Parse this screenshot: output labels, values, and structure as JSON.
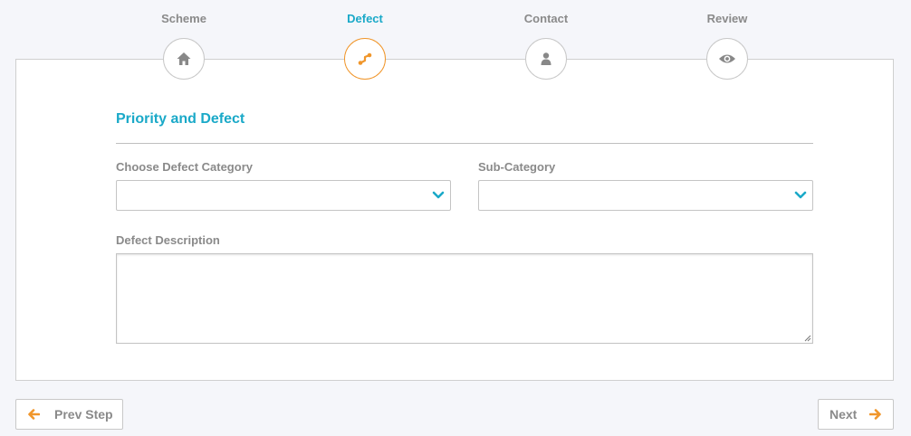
{
  "wizard": {
    "steps": [
      {
        "label": "Scheme",
        "icon": "home-icon",
        "active": false
      },
      {
        "label": "Defect",
        "icon": "defect-icon",
        "active": true
      },
      {
        "label": "Contact",
        "icon": "user-icon",
        "active": false
      },
      {
        "label": "Review",
        "icon": "eye-icon",
        "active": false
      }
    ]
  },
  "form": {
    "section_title": "Priority and Defect",
    "category": {
      "label": "Choose Defect Category",
      "value": ""
    },
    "subcategory": {
      "label": "Sub-Category",
      "value": ""
    },
    "description": {
      "label": "Defect Description",
      "value": ""
    }
  },
  "nav": {
    "prev_label": "Prev Step",
    "next_label": "Next"
  },
  "colors": {
    "accent_teal": "#1aa9c8",
    "accent_orange": "#f0962b",
    "muted_text": "#8a8a8a"
  }
}
